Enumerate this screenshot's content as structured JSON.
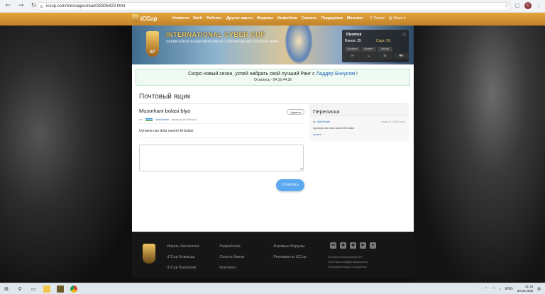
{
  "browser": {
    "url": "iccup.com/messages/read/28306423.html",
    "profile_initial": "C"
  },
  "topnav": {
    "logo": "iCCup",
    "links": [
      "Новости",
      "DotA",
      "Рейтинг",
      "Другие карты",
      "Форумы",
      "Инфобаза",
      "Скачать",
      "Поддержка",
      "Магазин"
    ],
    "search": "Поиск",
    "language": "Язык"
  },
  "banner": {
    "title": "INTERNATIONAL CYBER CUP",
    "subtitle": "СОРЕВНУЙСЯ НА МИРОВОЙ АРЕНЕ С СОПЕРНИКАМИ СО ВСЕГО МИРА",
    "medal_number": "67"
  },
  "userbox": {
    "username": "Diyorbek",
    "runes_label": "Runes: 25",
    "cups_label": "Cups: 39",
    "buttons": [
      "Профиль",
      "Аккаунт",
      "Выход"
    ]
  },
  "notice": {
    "text": "Скоро новый сезон, успей набрать свой лучший Ранг с",
    "link": "Ладдер Бонусом",
    "suffix": "!",
    "countdown": "Осталось - 04:16:44:36"
  },
  "page": {
    "title": "Почтовый ящик"
  },
  "message": {
    "subject": "Musorkani bolasi blya",
    "delete_label": "Удалить",
    "from_prefix": "от:",
    "author": "iAmGeraki",
    "date": "today at 16:08 local",
    "body": "Uynama nax dota xaromi itti bolasi",
    "reply_button": "Ответить"
  },
  "sidebar": {
    "title": "Переписка",
    "item": {
      "from_prefix": "от:",
      "author": "iAmGeraki",
      "date": "today at 16:08 local",
      "preview": "Uynama nax dota xaromi itti bolasi",
      "more": "читать..."
    }
  },
  "footer": {
    "col1": [
      "Играть бесплатно",
      "iCCup Команда",
      "iCCup Вакансии"
    ],
    "col2": [
      "Разработка",
      "Список банов",
      "Контакты"
    ],
    "col3": [
      "Игровые Форумы",
      "Реклама на iCCup"
    ],
    "socials": [
      "vk-icon",
      "discord-icon",
      "discord-icon",
      "youtube-icon",
      "telegram-icon"
    ],
    "legal": [
      "Условия использования iM+",
      "Политика конфиденциальности",
      "Пользовательское соглашение"
    ]
  },
  "taskbar": {
    "lang": "ENG",
    "time": "21:15",
    "date": "30.08.2025"
  }
}
